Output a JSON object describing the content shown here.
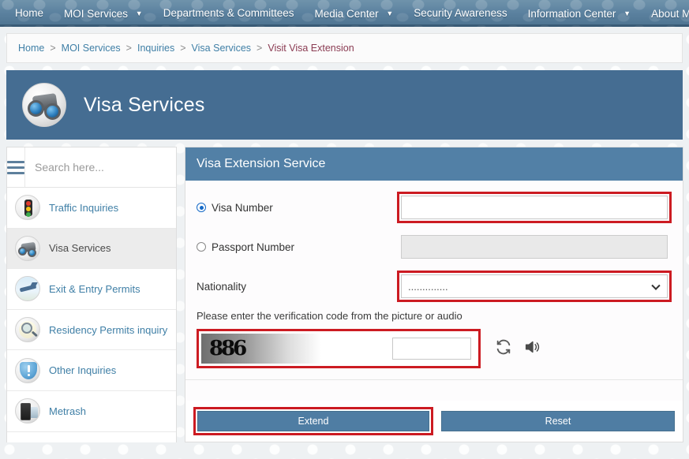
{
  "topnav": {
    "items": [
      {
        "label": "Home",
        "has_caret": false
      },
      {
        "label": "MOI Services",
        "has_caret": true
      },
      {
        "label": "Departments & Committees",
        "has_caret": false
      },
      {
        "label": "Media Center",
        "has_caret": true
      },
      {
        "label": "Security Awareness",
        "has_caret": false
      },
      {
        "label": "Information Center",
        "has_caret": true
      },
      {
        "label": "About Ministry",
        "has_caret": true
      }
    ]
  },
  "breadcrumb": {
    "items": [
      {
        "label": "Home",
        "current": false
      },
      {
        "label": "MOI Services",
        "current": false
      },
      {
        "label": "Inquiries",
        "current": false
      },
      {
        "label": "Visa Services",
        "current": false
      },
      {
        "label": "Visit Visa Extension",
        "current": true
      }
    ],
    "separator": ">"
  },
  "banner": {
    "title": "Visa Services",
    "icon": "binoculars-icon"
  },
  "sidebar": {
    "search": {
      "placeholder": "Search here...",
      "value": ""
    },
    "menu_icon": "hamburger-icon",
    "items": [
      {
        "label": "Traffic Inquiries",
        "icon": "traffic-light-icon",
        "active": false
      },
      {
        "label": "Visa Services",
        "icon": "binoculars-icon",
        "active": true
      },
      {
        "label": "Exit & Entry Permits",
        "icon": "airplane-icon",
        "active": false
      },
      {
        "label": "Residency Permits inquiry",
        "icon": "magnifier-document-icon",
        "active": false
      },
      {
        "label": "Other Inquiries",
        "icon": "exclamation-icon",
        "active": false
      },
      {
        "label": "Metrash",
        "icon": "mobile-phone-icon",
        "active": false
      }
    ]
  },
  "panel": {
    "title": "Visa Extension Service",
    "visa_number": {
      "label": "Visa Number",
      "selected": true,
      "value": "",
      "highlighted": true
    },
    "passport_number": {
      "label": "Passport Number",
      "selected": false,
      "value": "",
      "disabled": true,
      "highlighted": false
    },
    "nationality": {
      "label": "Nationality",
      "selected_option": "..............",
      "options": [
        ".............."
      ],
      "highlighted": true
    },
    "captcha": {
      "note": "Please enter the verification code from the picture or audio",
      "image_text": "886",
      "input_value": "",
      "refresh_icon": "refresh-icon",
      "audio_icon": "speaker-icon",
      "highlighted": true
    },
    "buttons": {
      "submit": {
        "label": "Extend",
        "highlighted": true
      },
      "reset": {
        "label": "Reset",
        "highlighted": false
      }
    }
  },
  "colors": {
    "nav_blue": "#5c82a0",
    "banner_blue": "#456d92",
    "panel_header_blue": "#5280a6",
    "button_blue": "#4f7da3",
    "link_blue": "#3f7fa6",
    "breadcrumb_current": "#8a3b52",
    "highlight_red": "#cc1b22",
    "radio_blue": "#1569c7"
  }
}
